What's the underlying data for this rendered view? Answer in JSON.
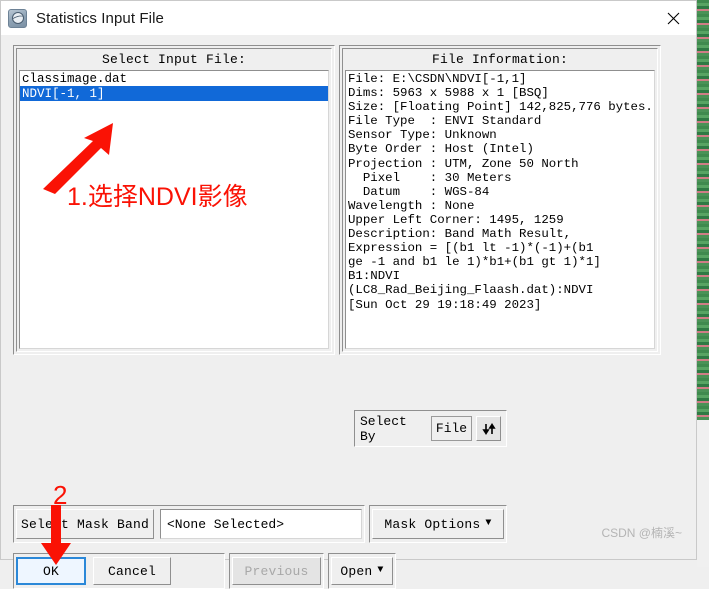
{
  "window": {
    "title": "Statistics Input File",
    "app_icon": "envi-globe-icon",
    "close_icon": "close-icon"
  },
  "left_panel": {
    "title": "Select Input File:",
    "items": [
      {
        "label": "classimage.dat",
        "selected": false
      },
      {
        "label": "NDVI[-1, 1]",
        "selected": true
      }
    ]
  },
  "right_panel": {
    "title": "File Information:",
    "lines": [
      "File: E:\\CSDN\\NDVI[-1,1]",
      "Dims: 5963 x 5988 x 1 [BSQ]",
      "Size: [Floating Point] 142,825,776 bytes.",
      "File Type  : ENVI Standard",
      "Sensor Type: Unknown",
      "Byte Order : Host (Intel)",
      "Projection : UTM, Zone 50 North",
      "  Pixel    : 30 Meters",
      "  Datum    : WGS-84",
      "Wavelength : None",
      "Upper Left Corner: 1495, 1259",
      "Description: Band Math Result,",
      "Expression = [(b1 lt -1)*(-1)+(b1",
      "ge -1 and b1 le 1)*b1+(b1 gt 1)*1]",
      "B1:NDVI",
      "(LC8_Rad_Beijing_Flaash.dat):NDVI",
      "[Sun Oct 29 19:18:49 2023]"
    ]
  },
  "select_by": {
    "label": "Select By",
    "value": "File",
    "toggle_icon": "up-down-arrows-icon"
  },
  "mask_row": {
    "select_mask_band_label": "Select Mask Band",
    "mask_value": "<None Selected>",
    "mask_options_label": "Mask Options",
    "mask_options_caret": "▼"
  },
  "actions": {
    "ok_label": "OK",
    "cancel_label": "Cancel",
    "previous_label": "Previous",
    "open_label": "Open",
    "open_caret": "▼"
  },
  "annotations": {
    "step1_text": "1.选择NDVI影像",
    "step2_text": "2",
    "arrow_color": "#fa1205"
  },
  "watermark": {
    "text": "CSDN @楠溪~"
  }
}
